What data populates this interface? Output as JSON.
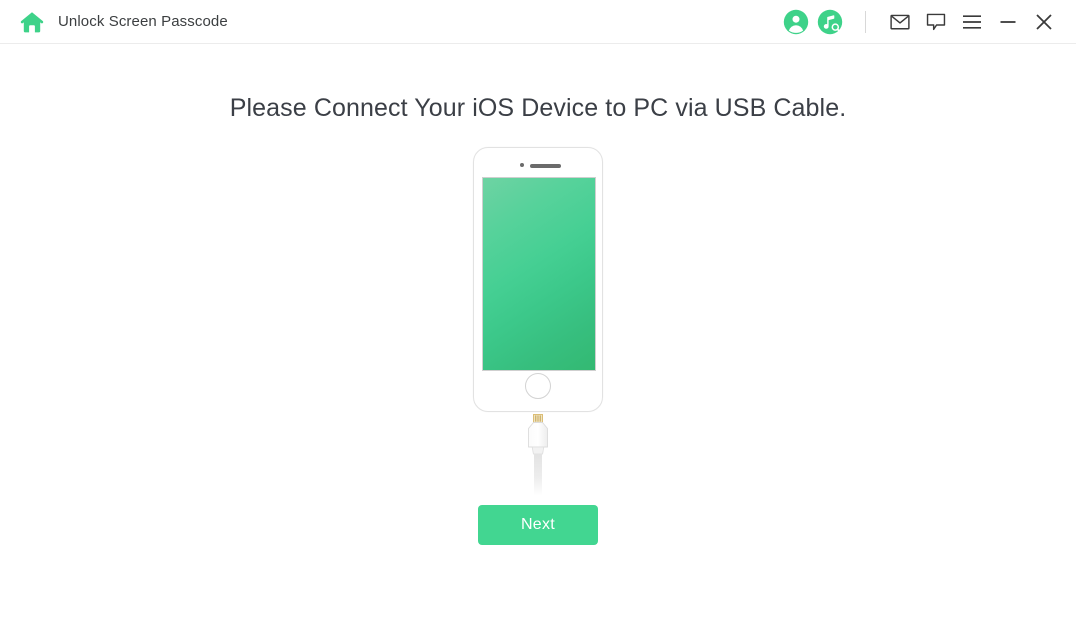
{
  "titlebar": {
    "home_icon": "home-icon",
    "app_title": "Unlock Screen Passcode",
    "account_icon": "account-circle-icon",
    "music_search_icon": "music-search-circle-icon",
    "mail_icon": "mail-icon",
    "feedback_icon": "feedback-chat-icon",
    "menu_icon": "hamburger-menu-icon",
    "minimize_icon": "minimize-icon",
    "close_icon": "close-icon"
  },
  "main": {
    "heading": "Please Connect Your iOS Device to PC via USB Cable.",
    "device_illustration": "iphone-with-lightning-cable-illustration",
    "next_label": "Next"
  },
  "colors": {
    "accent_green": "#42d691",
    "icon_green": "#3ed289",
    "screen_gradient_start": "#6ed3a3",
    "screen_gradient_end": "#33b972",
    "heading_text": "#3b3f46",
    "titlebar_text": "#3c3f41",
    "icon_dark": "#3a3a3a",
    "border_light": "#ececec",
    "connector_gold": "#d9b86a"
  }
}
